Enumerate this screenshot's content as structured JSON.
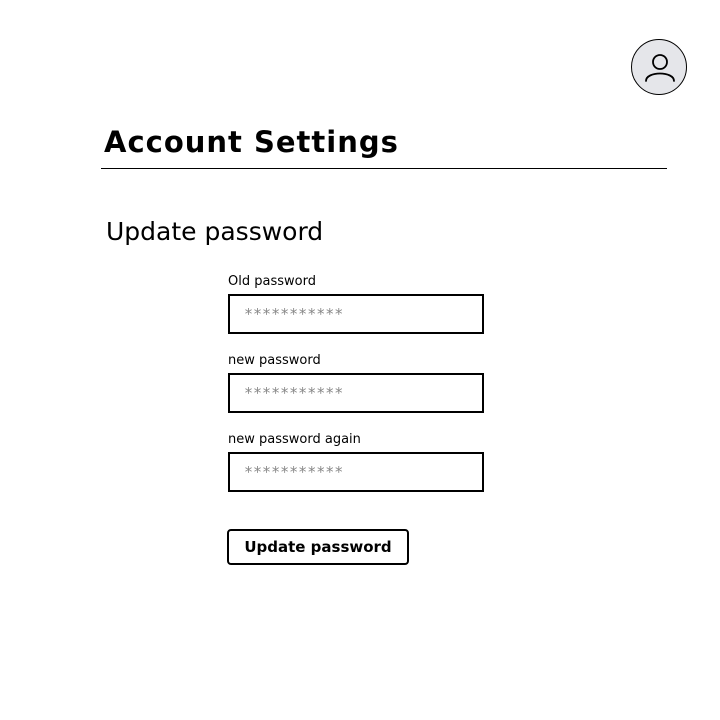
{
  "header": {
    "avatar_icon": "user-icon",
    "title": "Account Settings"
  },
  "section": {
    "title": "Update password"
  },
  "form": {
    "fields": [
      {
        "label": "Old password",
        "placeholder": "***********"
      },
      {
        "label": "new password",
        "placeholder": "***********"
      },
      {
        "label": "new password again",
        "placeholder": "***********"
      }
    ],
    "submit_label": "Update password"
  },
  "colors": {
    "avatar_background": "#e5e6ea",
    "placeholder_text": "#888888",
    "border": "#000000"
  }
}
